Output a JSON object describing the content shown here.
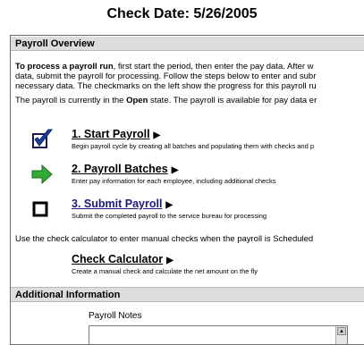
{
  "header": {
    "check_date": "Check Date: 5/26/2005"
  },
  "overview": {
    "title": "Payroll Overview",
    "intro_bold": "To process a payroll run",
    "intro_line1_rest": ", first start the period, then enter the pay data. After w",
    "intro_line2": "data, submit the payroll for processing. Follow the steps below to enter and subr",
    "intro_line3": "necessary data. The checkmarks on the left show the progress for this payroll ru",
    "state_prefix": "The payroll is currently in the ",
    "state_value": "Open",
    "state_suffix": " state. The payroll is available for pay data er"
  },
  "steps": [
    {
      "title": "1. Start Payroll",
      "desc": "Begin payroll cycle by creating all batches and populating them with checks and p",
      "icon": "checkmark-icon"
    },
    {
      "title": "2. Payroll Batches",
      "desc": "Enter pay information for each employee, including additional checks",
      "icon": "arrow-right-icon"
    },
    {
      "title": "3. Submit Payroll",
      "desc": "Submit the completed payroll to the service bureau for processing",
      "icon": "empty-square-icon"
    }
  ],
  "calculator": {
    "intro": "Use the check calculator to enter manual checks when the payroll is Scheduled",
    "title": "Check Calculator",
    "desc": "Create a manual check and calculate the net amount on the fly"
  },
  "additional": {
    "title": "Additional Information",
    "notes_label": "Payroll Notes",
    "notes_value": ""
  },
  "colors": {
    "header_bg": "#dddddd",
    "link_active": "#1a1a7e",
    "check_blue": "#1a3fa0",
    "arrow_green": "#33aa33"
  }
}
